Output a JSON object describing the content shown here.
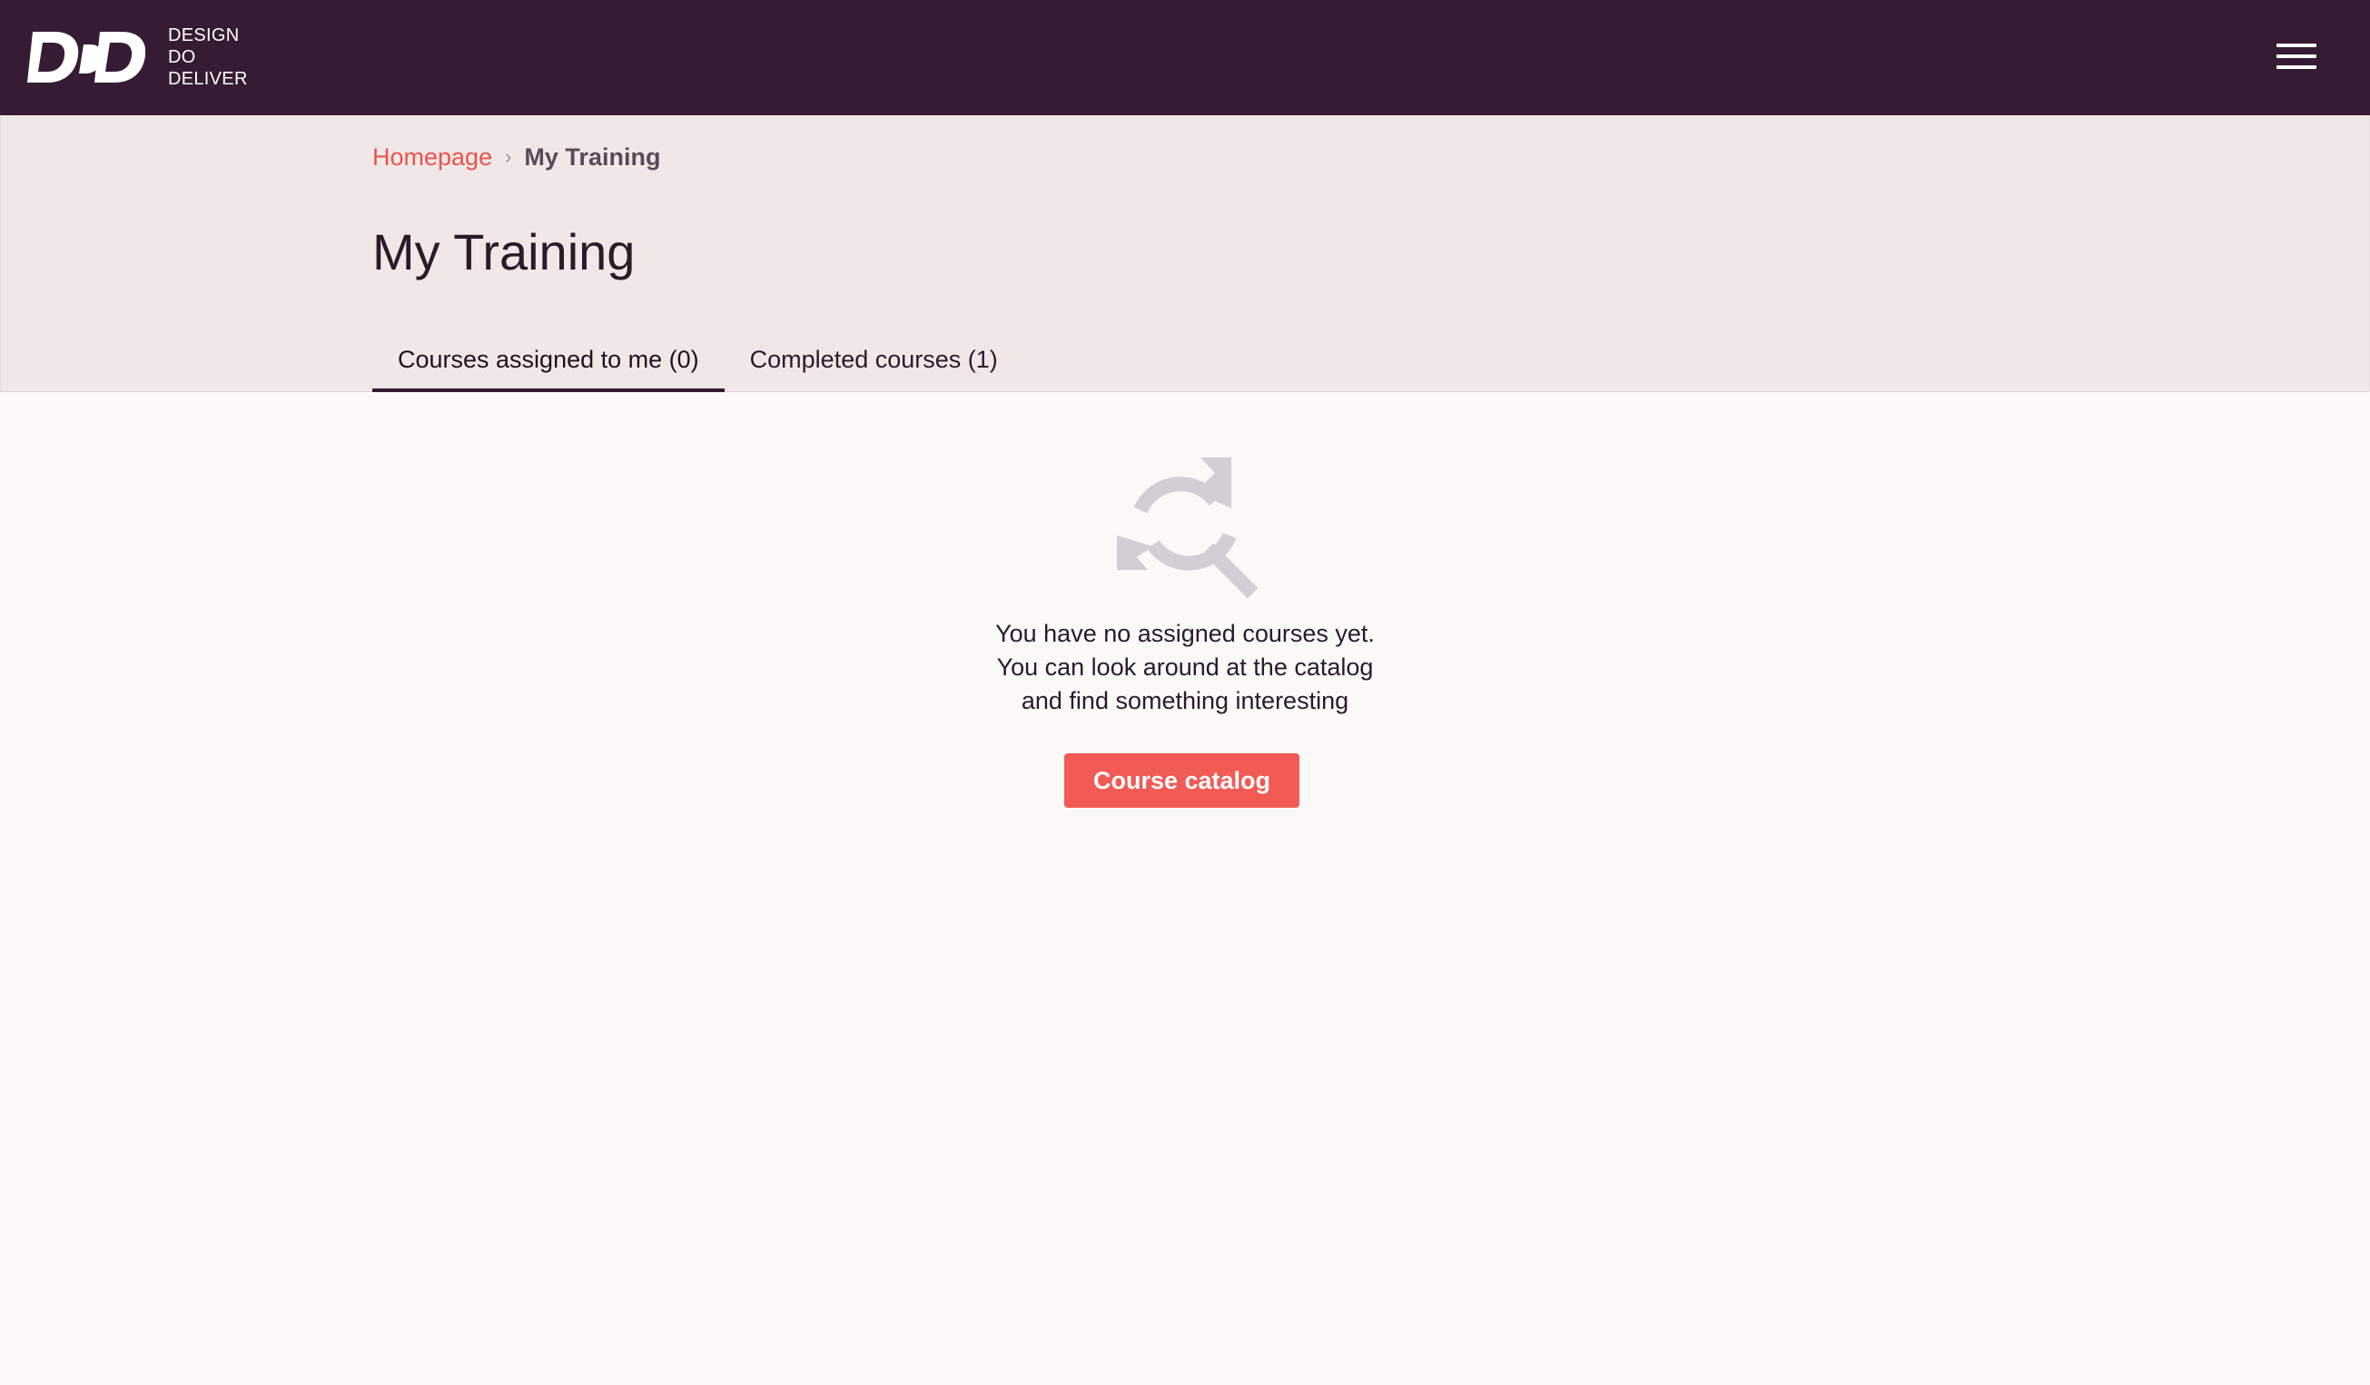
{
  "header": {
    "logo_mark": "DDD",
    "logo_lines": [
      "DESIGN",
      "DO",
      "DELIVER"
    ],
    "menu_icon": "hamburger-menu-icon"
  },
  "breadcrumb": {
    "home": "Homepage",
    "separator": "›",
    "current": "My Training"
  },
  "page": {
    "title": "My Training"
  },
  "tabs": [
    {
      "label": "Courses assigned to me (0)",
      "active": true
    },
    {
      "label": "Completed courses (1)",
      "active": false
    }
  ],
  "empty_state": {
    "icon": "refresh-search-icon",
    "lines": [
      "You have no assigned courses yet.",
      "You can look around at the catalog",
      "and find something interesting"
    ],
    "button_label": "Course catalog"
  },
  "colors": {
    "topbar": "#361c33",
    "header_band": "#f2e7e7",
    "accent": "#f25a55",
    "link": "#e8544e",
    "icon_gray": "#d3ced4"
  }
}
